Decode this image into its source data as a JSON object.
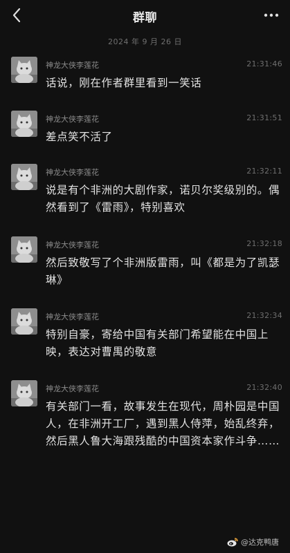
{
  "header": {
    "title": "群聊",
    "back_icon": "back-chevron-icon",
    "more_icon": "more-dots-icon"
  },
  "date_divider": "2024 年 9 月 26 日",
  "messages": [
    {
      "sender": "神龙大侠李莲花",
      "time": "21:31:46",
      "text": "话说，刚在作者群里看到一笑话"
    },
    {
      "sender": "神龙大侠李莲花",
      "time": "21:31:51",
      "text": "差点笑不活了"
    },
    {
      "sender": "神龙大侠李莲花",
      "time": "21:32:11",
      "text": "说是有个非洲的大剧作家，诺贝尔奖级别的。偶然看到了《雷雨》，特别喜欢"
    },
    {
      "sender": "神龙大侠李莲花",
      "time": "21:32:18",
      "text": "然后致敬写了个非洲版雷雨，叫《都是为了凯瑟琳》"
    },
    {
      "sender": "神龙大侠李莲花",
      "time": "21:32:34",
      "text": "特别自豪，寄给中国有关部门希望能在中国上映，表达对曹禺的敬意"
    },
    {
      "sender": "神龙大侠李莲花",
      "time": "21:32:40",
      "text": "有关部门一看，故事发生在现代，周朴园是中国人，在非洲开工厂，遇到黑人侍萍，始乱终弃，然后黑人鲁大海跟残酷的中国资本家作斗争……"
    }
  ],
  "watermark": {
    "text": "@达克鸭唐",
    "icon": "weibo-icon"
  },
  "colors": {
    "background": "#111111",
    "text": "#e2e2e2",
    "meta": "#6f6f6f",
    "name": "#8c8c8c"
  }
}
